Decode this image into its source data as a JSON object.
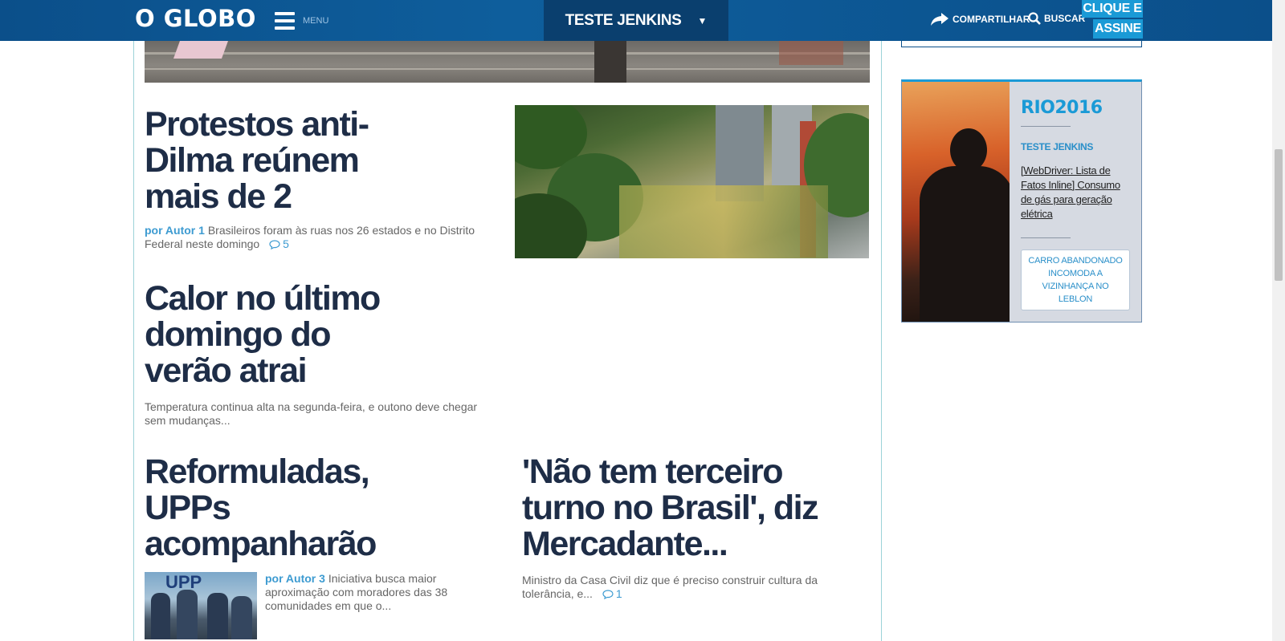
{
  "header": {
    "logo": "O GLOBO",
    "menu_label": "MENU",
    "section_title": "TESTE JENKINS",
    "section_arrow": "▼",
    "share_label": "COMPARTILHAR",
    "search_label": "BUSCAR",
    "subscribe_line1": "CLIQUE E",
    "subscribe_line2": "ASSINE"
  },
  "articles": [
    {
      "headline": "Protestos anti-Dilma reúnem mais de 2",
      "author": "por Autor 1",
      "excerpt": "Brasileiros foram às ruas nos 26 estados e no Distrito Federal neste domingo",
      "comments": "5"
    },
    {
      "headline": "Calor no último domingo do verão atrai",
      "excerpt": "Temperatura continua alta na segunda-feira, e outono deve chegar sem mudanças..."
    },
    {
      "headline": "Reformuladas, UPPs acompanharão",
      "author": "por Autor 3",
      "excerpt": "Iniciativa busca maior aproximação com moradores das 38 comunidades em que o...",
      "image_text": "UPP"
    },
    {
      "headline": "'Não tem terceiro turno no Brasil', diz Mercadante...",
      "excerpt": "Ministro da Casa Civil diz que é preciso construir cultura da tolerância, e...",
      "comments": "1"
    }
  ],
  "sidebar": {
    "promo": {
      "logo_rio": "RIO",
      "logo_year": "2016",
      "section": "TESTE JENKINS",
      "link": "[WebDriver: Lista de Fatos Inline] Consumo de gás para geração elétrica",
      "button": "CARRO ABANDONADO INCOMODA A VIZINHANÇA NO LEBLON"
    }
  },
  "colors": {
    "header_bg": "#0b4f8a",
    "accent": "#1a9ad6",
    "headline": "#1e2d47",
    "author": "#3d9bd1"
  }
}
